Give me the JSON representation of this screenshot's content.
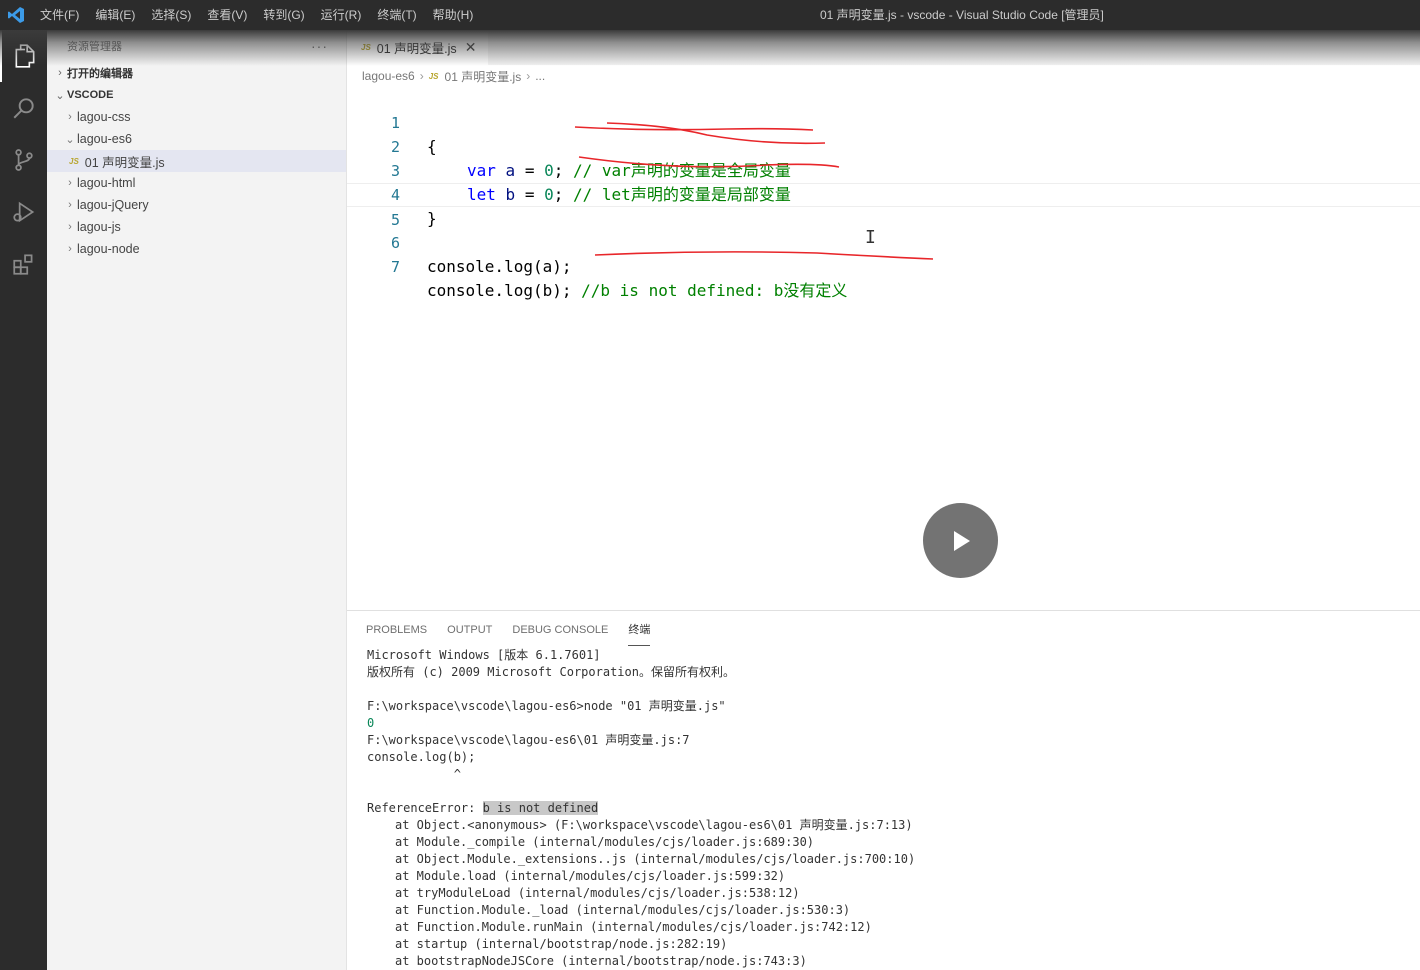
{
  "titlebar": {
    "menus": [
      "文件(F)",
      "编辑(E)",
      "选择(S)",
      "查看(V)",
      "转到(G)",
      "运行(R)",
      "终端(T)",
      "帮助(H)"
    ],
    "window_title": "01 声明变量.js - vscode - Visual Studio Code [管理员]"
  },
  "sidebar": {
    "title": "资源管理器",
    "more": "···",
    "open_editors": "打开的编辑器",
    "workspace": "VSCODE",
    "folders": [
      {
        "label": "lagou-css"
      },
      {
        "label": "lagou-es6"
      },
      {
        "label": "lagou-html"
      },
      {
        "label": "lagou-jQuery"
      },
      {
        "label": "lagou-js"
      },
      {
        "label": "lagou-node"
      }
    ],
    "selected_file": {
      "badge": "JS",
      "label": "01 声明变量.js"
    }
  },
  "tabs": [
    {
      "badge": "JS",
      "label": "01 声明变量.js",
      "close": "✕"
    }
  ],
  "breadcrumbs": {
    "folder": "lagou-es6",
    "file_badge": "JS",
    "file": "01 声明变量.js",
    "tail": "..."
  },
  "editor": {
    "line_numbers": [
      "1",
      "2",
      "3",
      "4",
      "5",
      "6",
      "7"
    ],
    "line1": "{",
    "line2": {
      "kw": "var",
      "id": "a",
      "eq": " = ",
      "num": "0",
      "semi": ";",
      "comment": "// var声明的变量是全局变量"
    },
    "line3": {
      "kw": "let",
      "id": "b",
      "eq": " = ",
      "num": "0",
      "semi": ";",
      "comment": "// let声明的变量是局部变量"
    },
    "line4": "}",
    "line6": "console.log(a);",
    "line7": {
      "code": "console.log(b);",
      "comment": "//b is not defined: b没有定义"
    },
    "annotation_color": "#e8262a"
  },
  "panel": {
    "tabs": [
      "PROBLEMS",
      "OUTPUT",
      "DEBUG CONSOLE",
      "终端"
    ],
    "terminal": {
      "l1": "Microsoft Windows [版本 6.1.7601]",
      "l2": "版权所有 (c) 2009 Microsoft Corporation。保留所有权利。",
      "l3": "F:\\workspace\\vscode\\lagou-es6>node \"01 声明变量.js\"",
      "l4": "0",
      "l5": "F:\\workspace\\vscode\\lagou-es6\\01 声明变量.js:7",
      "l6": "console.log(b);",
      "l7": "            ^",
      "err_prefix": "ReferenceError: ",
      "err_msg": "b is not defined",
      "stack": [
        "at Object.<anonymous> (F:\\workspace\\vscode\\lagou-es6\\01 声明变量.js:7:13)",
        "at Module._compile (internal/modules/cjs/loader.js:689:30)",
        "at Object.Module._extensions..js (internal/modules/cjs/loader.js:700:10)",
        "at Module.load (internal/modules/cjs/loader.js:599:32)",
        "at tryModuleLoad (internal/modules/cjs/loader.js:538:12)",
        "at Function.Module._load (internal/modules/cjs/loader.js:530:3)",
        "at Function.Module.runMain (internal/modules/cjs/loader.js:742:12)",
        "at startup (internal/bootstrap/node.js:282:19)",
        "at bootstrapNodeJSCore (internal/bootstrap/node.js:743:3)"
      ]
    }
  }
}
